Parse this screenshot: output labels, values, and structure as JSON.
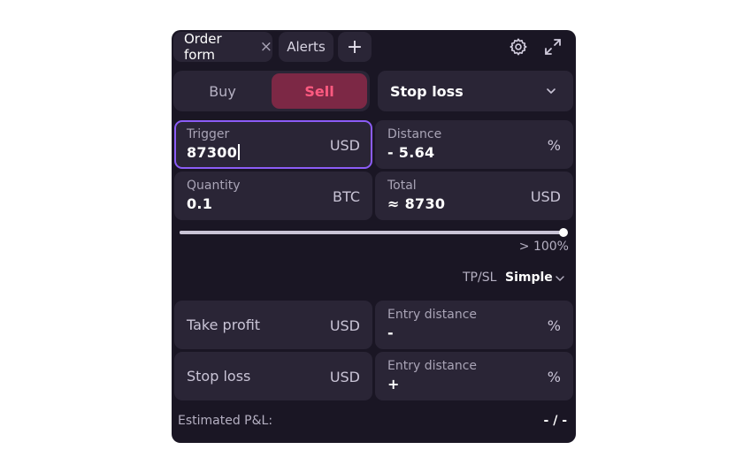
{
  "tabs": [
    {
      "label": "Order form",
      "active": true
    },
    {
      "label": "Alerts",
      "active": false
    }
  ],
  "tab_close_glyph": "×",
  "add_tab_glyph": "+",
  "header_icons": [
    "gear-icon",
    "expand-icon"
  ],
  "side": {
    "buy_label": "Buy",
    "sell_label": "Sell",
    "selected": "Sell"
  },
  "order_type": {
    "selected": "Stop loss"
  },
  "fields": {
    "trigger": {
      "label": "Trigger",
      "value": "87300",
      "unit": "USD"
    },
    "distance": {
      "label": "Distance",
      "value": "- 5.64",
      "unit": "%"
    },
    "quantity": {
      "label": "Quantity",
      "value": "0.1",
      "unit": "BTC"
    },
    "total": {
      "label": "Total",
      "value": "≈ 8730",
      "unit": "USD"
    }
  },
  "slider": {
    "value_percent": 100,
    "label": "> 100%"
  },
  "tpsl": {
    "label": "TP/SL",
    "mode": "Simple"
  },
  "take_profit": {
    "label": "Take profit",
    "unit": "USD",
    "entry_label": "Entry distance",
    "entry_value": "-",
    "entry_unit": "%"
  },
  "stop_loss": {
    "label": "Stop loss",
    "unit": "USD",
    "entry_label": "Entry distance",
    "entry_value": "+",
    "entry_unit": "%"
  },
  "estimated_pnl": {
    "label": "Estimated P&L:",
    "value": "- / -"
  },
  "colors": {
    "panel": "#1a1624",
    "field": "#2a2536",
    "sell": "#ff5a80",
    "sell_bg": "#7c2845",
    "focus": "#8b5cf6"
  }
}
